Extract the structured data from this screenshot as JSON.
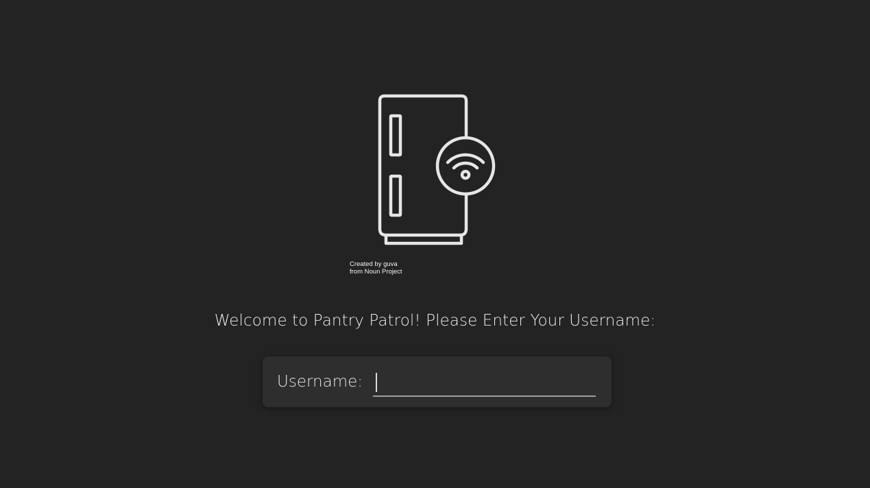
{
  "logo": {
    "icon": "smart-fridge-wifi-icon",
    "credit_line1": "Created by guva",
    "credit_line2": "from Noun Project"
  },
  "welcome_text": "Welcome to Pantry Patrol! Please Enter Your Username:",
  "login": {
    "label": "Username:",
    "value": "",
    "placeholder": ""
  },
  "colors": {
    "background": "#232323",
    "card": "#2e2e2e",
    "text": "#e8e8e8",
    "icon_stroke": "#e6e6e6",
    "input_underline": "#a0a0a0"
  }
}
